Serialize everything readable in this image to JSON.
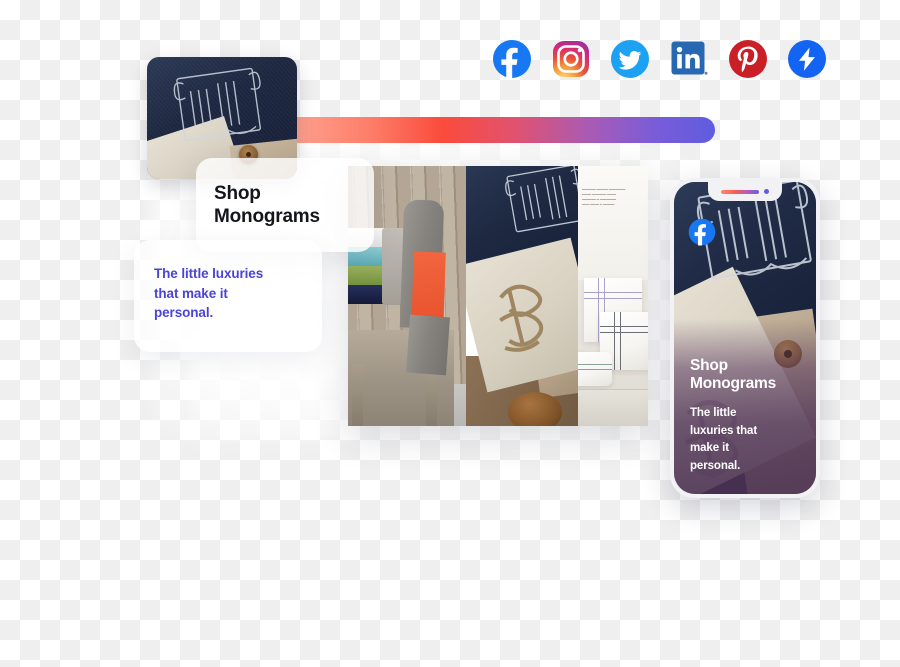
{
  "social_icons": [
    {
      "name": "facebook-icon",
      "label": "Facebook",
      "color": "#1877F2"
    },
    {
      "name": "instagram-icon",
      "label": "Instagram",
      "color": "#E1306C"
    },
    {
      "name": "twitter-icon",
      "label": "Twitter",
      "color": "#1DA1F2"
    },
    {
      "name": "linkedin-icon",
      "label": "LinkedIn",
      "color": "#2867B2"
    },
    {
      "name": "pinterest-icon",
      "label": "Pinterest",
      "color": "#E60023"
    },
    {
      "name": "instant-articles-icon",
      "label": "Instant Articles",
      "color": "#1464F4"
    }
  ],
  "gradient_bar": {
    "start_color": "#ffc8bb",
    "mid_color": "#fb4b3c",
    "end_color": "#5f5ce0"
  },
  "shop_card": {
    "title": "Shop\nMonograms"
  },
  "blurb_card": {
    "text": "The little luxuries that make it personal.",
    "color": "#4a44d6"
  },
  "phone_preview": {
    "title": "Shop\nMonograms",
    "body": "The little\nluxuries that\nmake it\npersonal.",
    "badge_network": "Facebook"
  },
  "thumbnail": {
    "alt": "Navy monogrammed linen fabric with wooden spool"
  },
  "collage": {
    "panels": [
      {
        "alt": "Stacked colored towels on a wooden bench"
      },
      {
        "alt": "Navy and linen monogrammed textiles with wooden spool"
      },
      {
        "alt": "White pillows with striped borders in a catalog spread"
      }
    ]
  }
}
